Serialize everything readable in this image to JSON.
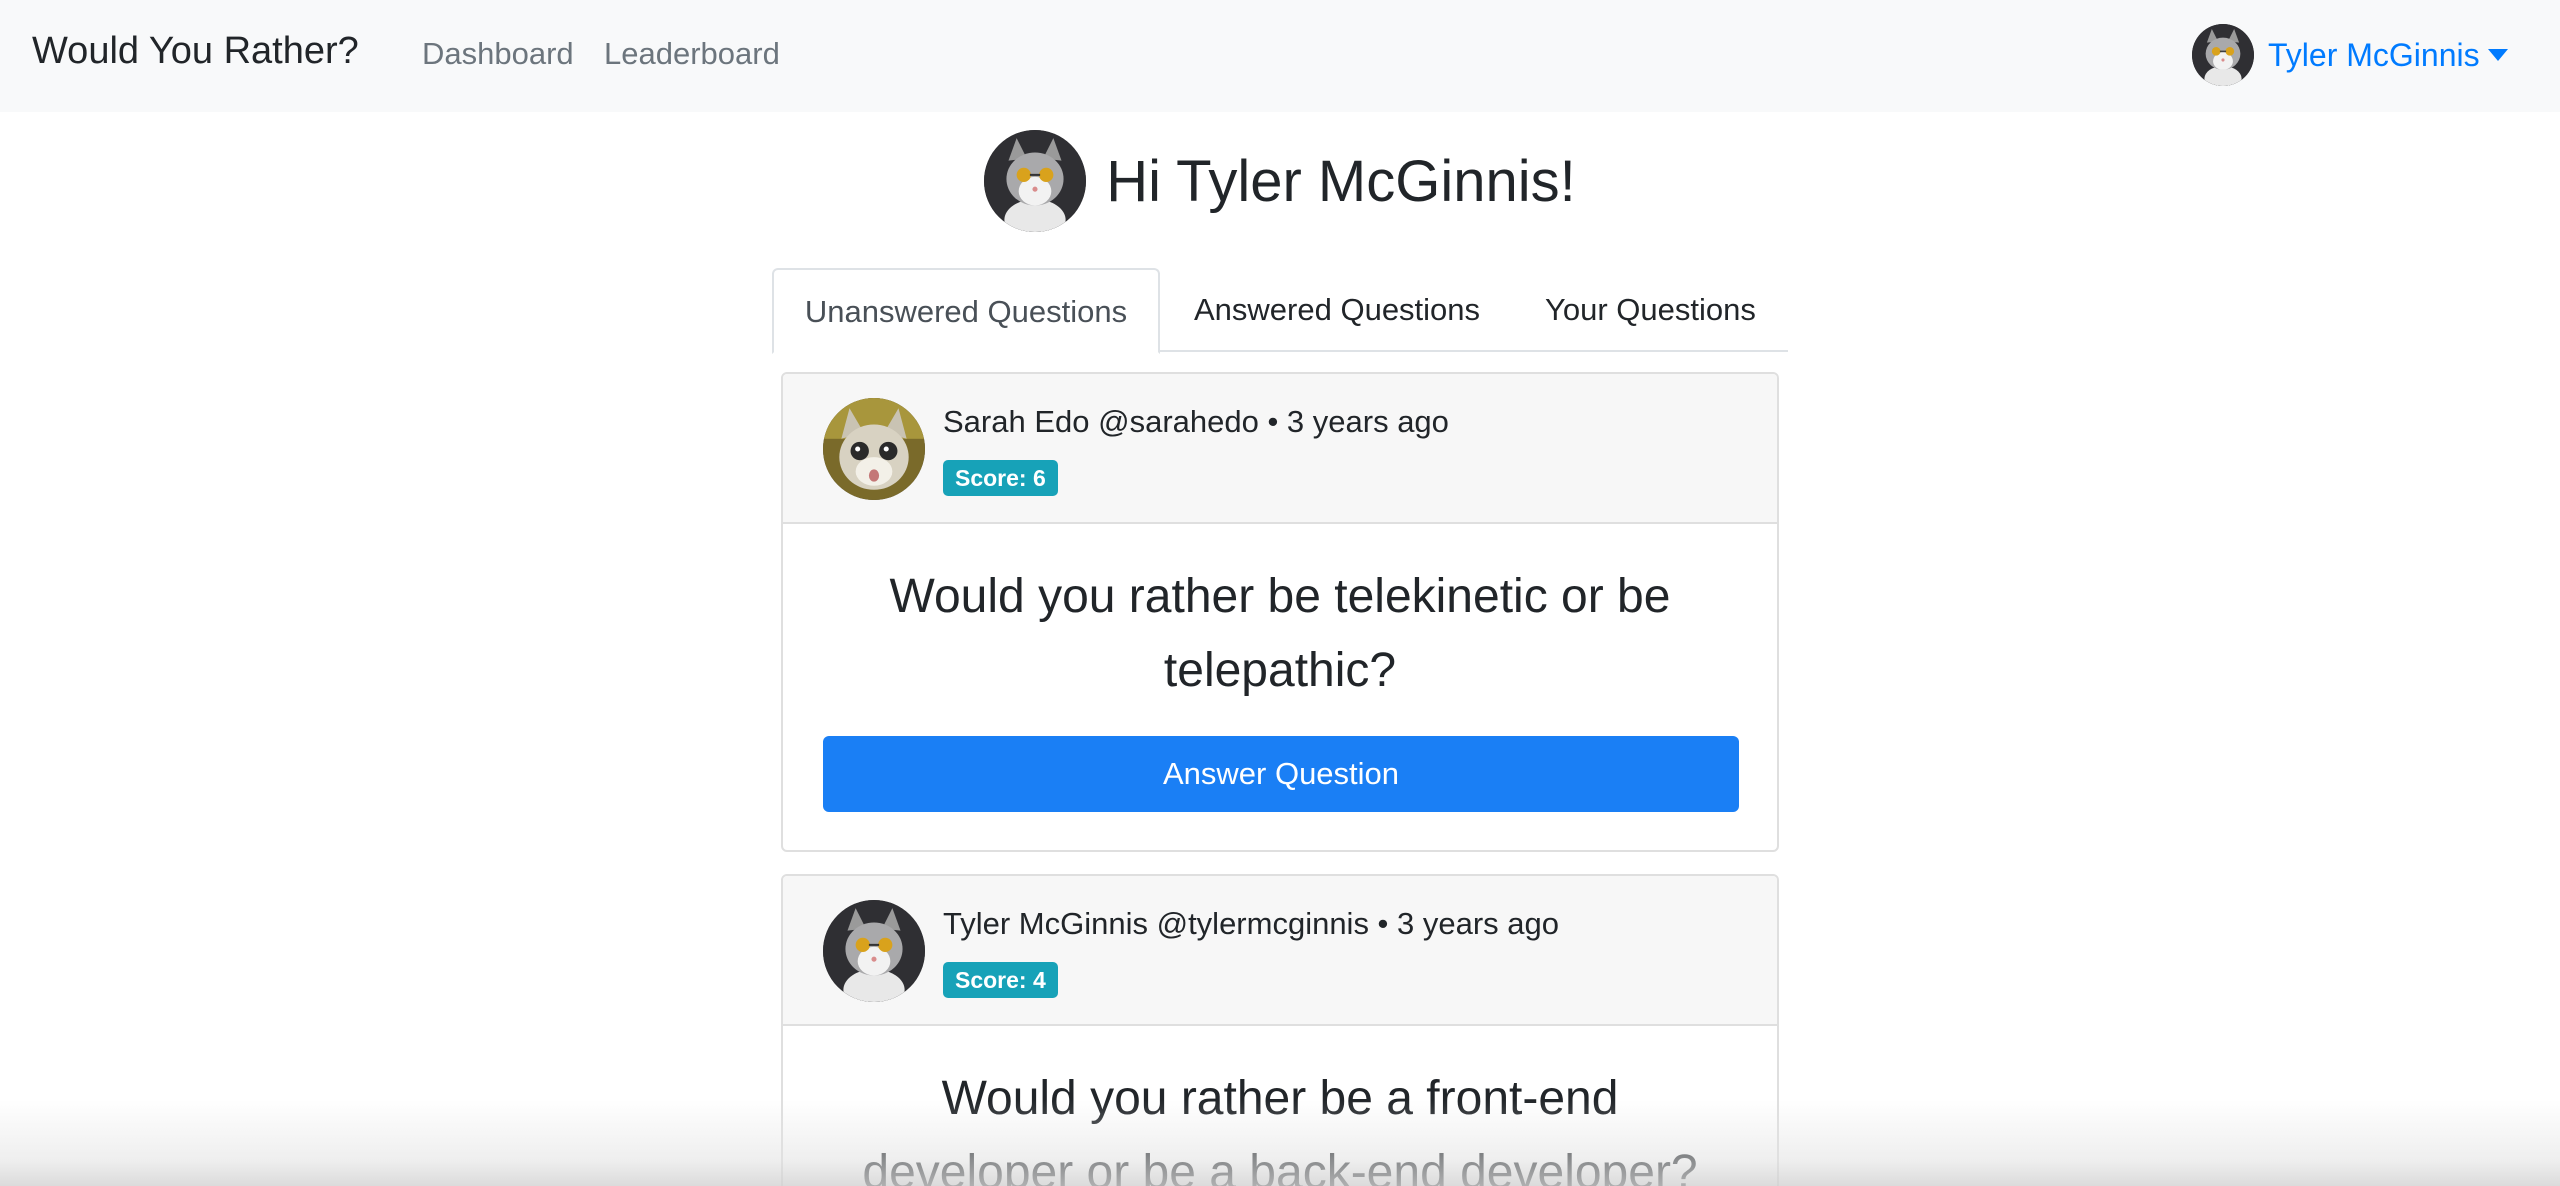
{
  "navbar": {
    "brand": "Would You Rather?",
    "links": [
      "Dashboard",
      "Leaderboard"
    ],
    "user_name": "Tyler McGinnis"
  },
  "greeting": "Hi Tyler McGinnis!",
  "tabs": [
    "Unanswered Questions",
    "Answered Questions",
    "Your Questions"
  ],
  "questions": [
    {
      "author_line": "Sarah Edo @sarahedo • 3 years ago",
      "score": "Score: 6",
      "text": "Would you rather be telekinetic or be telepathic?",
      "button": "Answer Question",
      "avatar_icon": "surprised-cat-avatar"
    },
    {
      "author_line": "Tyler McGinnis @tylermcginnis • 3 years ago",
      "score": "Score: 4",
      "text": "Would you rather be a front-end developer or be a back-end developer?",
      "avatar_icon": "sunglasses-cat-avatar"
    }
  ],
  "colors": {
    "primary": "#007bff",
    "button": "#1a7ff5",
    "badge": "#17a2b8",
    "navbar_bg": "#f8f9fa"
  }
}
